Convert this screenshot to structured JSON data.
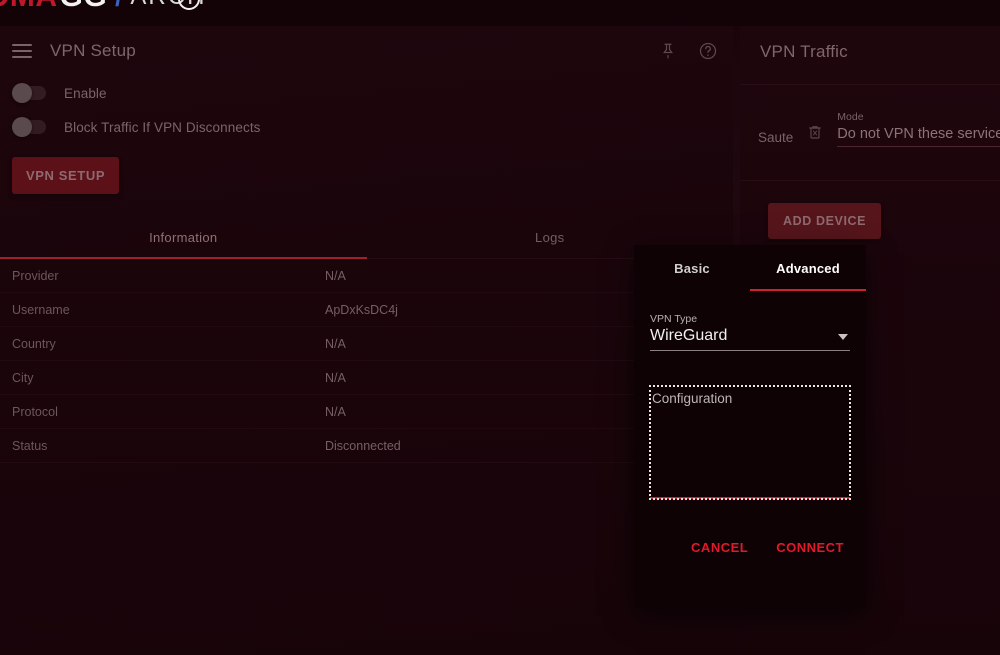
{
  "brand": {
    "part_a": "OMA",
    "part_b": "GG",
    "slash": "/",
    "part_c": "ARCH",
    "ring_icon": "circle-ring-icon"
  },
  "left_card": {
    "menu_icon": "hamburger-menu-icon",
    "title": "VPN Setup",
    "pin_icon": "pin-icon",
    "help_icon": "help-circle-icon",
    "toggles": [
      {
        "label": "Enable",
        "on": false
      },
      {
        "label": "Block Traffic If VPN Disconnects",
        "on": false
      }
    ],
    "setup_button": "VPN SETUP",
    "tabs": [
      {
        "label": "Information",
        "active": true
      },
      {
        "label": "Logs",
        "active": false
      }
    ],
    "info_rows": [
      {
        "key": "Provider",
        "value": "N/A"
      },
      {
        "key": "Username",
        "value": "ApDxKsDC4j"
      },
      {
        "key": "Country",
        "value": "N/A"
      },
      {
        "key": "City",
        "value": "N/A"
      },
      {
        "key": "Protocol",
        "value": "N/A"
      },
      {
        "key": "Status",
        "value": "Disconnected"
      }
    ]
  },
  "right_panel": {
    "title": "VPN Traffic",
    "device_name": "Saute",
    "delete_icon": "trash-delete-icon",
    "mode_label": "Mode",
    "mode_value": "Do not VPN these services",
    "add_device_button": "ADD DEVICE"
  },
  "modal": {
    "tabs": [
      {
        "label": "Basic",
        "active": false
      },
      {
        "label": "Advanced",
        "active": true
      }
    ],
    "vpn_type_label": "VPN Type",
    "vpn_type_value": "WireGuard",
    "dropdown_icon": "chevron-down-icon",
    "configuration_label": "Configuration",
    "configuration_value": "",
    "cancel_button": "CANCEL",
    "connect_button": "CONNECT"
  },
  "colors": {
    "accent_red": "#d12030",
    "button_red": "#5b1117",
    "page_bg": "#1a040a",
    "modal_bg": "#0e0205",
    "muted_text": "#7b6569"
  }
}
